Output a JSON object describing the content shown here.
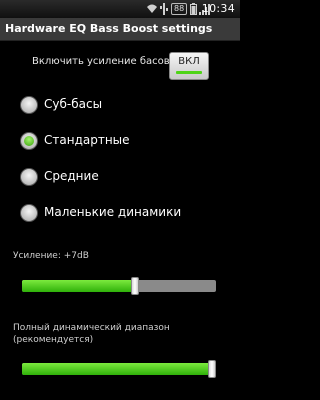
{
  "status_bar": {
    "battery_badge": "88",
    "time": "10:34",
    "icons": [
      "wifi-icon",
      "usb-icon",
      "battery-icon",
      "signal-icon"
    ]
  },
  "app": {
    "title": "Hardware EQ Bass Boost settings"
  },
  "enable": {
    "label": "Включить усиление басов",
    "toggle_label": "ВКЛ",
    "on": true
  },
  "modes": [
    {
      "label": "Суб-басы",
      "checked": false
    },
    {
      "label": "Стандартные",
      "checked": true
    },
    {
      "label": "Средние",
      "checked": false
    },
    {
      "label": "Маленькие динамики",
      "checked": false
    }
  ],
  "gain": {
    "label": "Усиление: +7dB",
    "fraction": 0.58
  },
  "range": {
    "label_line1": "Полный динамический диапазон",
    "label_line2": "(рекомендуется)",
    "fraction": 1.0
  },
  "colors": {
    "accent": "#4ed417",
    "background": "#000000",
    "title_bar": "#3a3a3a"
  }
}
